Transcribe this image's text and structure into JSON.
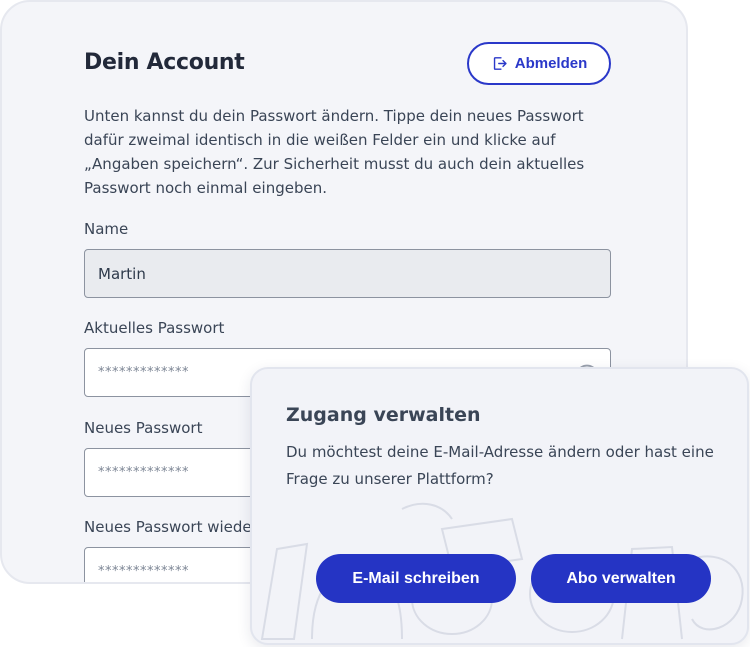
{
  "account": {
    "title": "Dein Account",
    "logout_label": "Abmelden",
    "intro": "Unten kannst du dein Passwort ändern. Tippe dein neues Passwort dafür zweimal identisch in die weißen Felder ein und klicke auf „Angaben speichern“. Zur Sicherheit musst du auch dein aktuelles Passwort noch einmal eingeben.",
    "fields": [
      {
        "label": "Name",
        "value": "Martin"
      },
      {
        "label": "Aktuelles Passwort",
        "value": "*************"
      },
      {
        "label": "Neues Passwort",
        "value": "*************"
      },
      {
        "label": "Neues Passwort wiede",
        "value": "*************"
      }
    ]
  },
  "access": {
    "title": "Zugang verwalten",
    "text": "Du möchtest deine E-Mail-Adresse ändern oder hast eine Frage zu unserer Plattform?",
    "email_button": "E-Mail schreiben",
    "abo_button": "Abo verwalten"
  },
  "colors": {
    "primary": "#2534c4",
    "card_bg": "#f4f5f9",
    "text": "#3a4556"
  }
}
